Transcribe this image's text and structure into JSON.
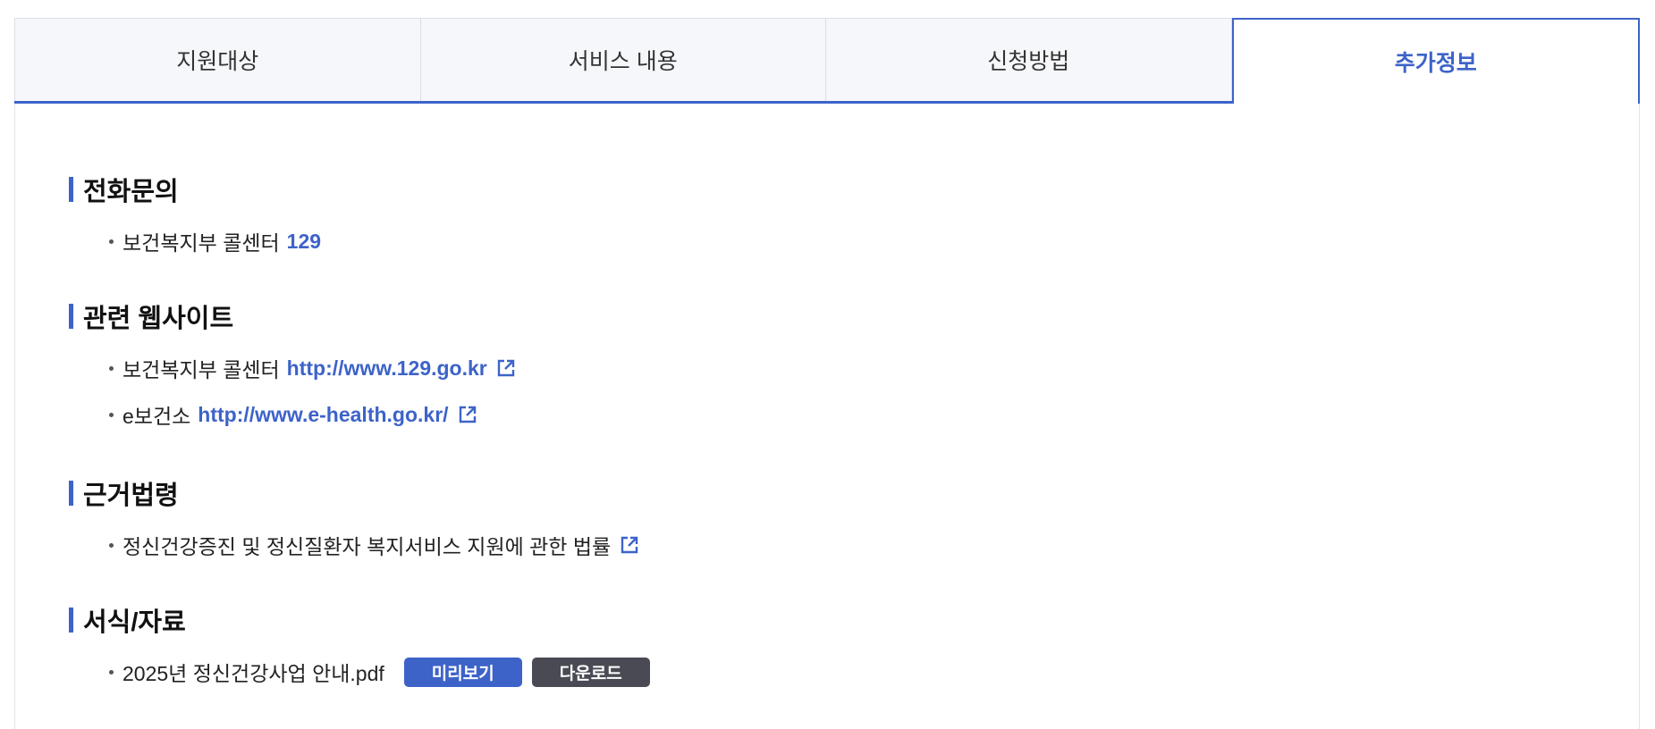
{
  "tabs": [
    {
      "label": "지원대상",
      "active": false
    },
    {
      "label": "서비스 내용",
      "active": false
    },
    {
      "label": "신청방법",
      "active": false
    },
    {
      "label": "추가정보",
      "active": true
    }
  ],
  "colors": {
    "accent": "#3d63c9",
    "dark_button": "#4a4a55"
  },
  "sections": {
    "phone": {
      "title": "전화문의",
      "items": [
        {
          "text": "보건복지부 콜센터",
          "link": "129"
        }
      ]
    },
    "websites": {
      "title": "관련 웹사이트",
      "items": [
        {
          "text": "보건복지부 콜센터",
          "link": "http://www.129.go.kr",
          "icon": "external-link-icon"
        },
        {
          "text": "e보건소",
          "link": "http://www.e-health.go.kr/",
          "icon": "external-link-icon"
        }
      ]
    },
    "law": {
      "title": "근거법령",
      "items": [
        {
          "text": "정신건강증진 및 정신질환자 복지서비스 지원에 관한 법률",
          "icon": "external-link-icon"
        }
      ]
    },
    "forms": {
      "title": "서식/자료",
      "items": [
        {
          "text": "2025년 정신건강사업 안내.pdf",
          "preview_label": "미리보기",
          "download_label": "다운로드"
        }
      ]
    }
  }
}
